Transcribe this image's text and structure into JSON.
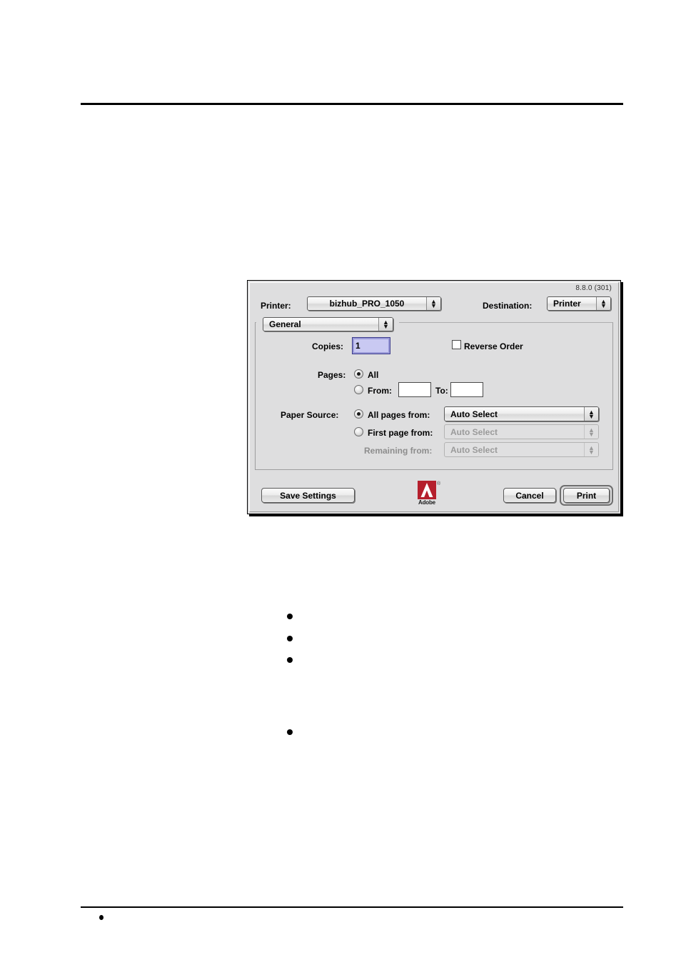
{
  "document": {
    "header_rule": true,
    "footer_rule": true,
    "bullets": [
      "",
      "",
      "",
      "",
      ""
    ]
  },
  "dialog": {
    "version": "8.8.0 (301)",
    "printer": {
      "label": "Printer:",
      "value": "bizhub_PRO_1050"
    },
    "destination": {
      "label": "Destination:",
      "value": "Printer"
    },
    "pane_popup": {
      "value": "General"
    },
    "copies": {
      "label": "Copies:",
      "value": "1"
    },
    "reverse_order": {
      "label": "Reverse Order",
      "checked": false
    },
    "pages": {
      "label": "Pages:",
      "all_label": "All",
      "from_label": "From:",
      "to_label": "To:",
      "from_value": "",
      "to_value": "",
      "selected": "all"
    },
    "paper_source": {
      "label": "Paper Source:",
      "all_pages_from_label": "All pages from:",
      "all_pages_from_value": "Auto Select",
      "first_page_from_label": "First page from:",
      "first_page_from_value": "Auto Select",
      "remaining_from_label": "Remaining from:",
      "remaining_from_value": "Auto Select",
      "selected": "all-pages-from"
    },
    "buttons": {
      "save_settings": "Save Settings",
      "cancel": "Cancel",
      "print": "Print"
    },
    "branding": {
      "name": "Adobe",
      "registered_mark": "®"
    },
    "colors": {
      "dialog_face": "#dededf",
      "focus_field": "#c9c9f2",
      "adobe_red": "#b51f2c",
      "disabled_text": "#9a9a9a"
    }
  }
}
